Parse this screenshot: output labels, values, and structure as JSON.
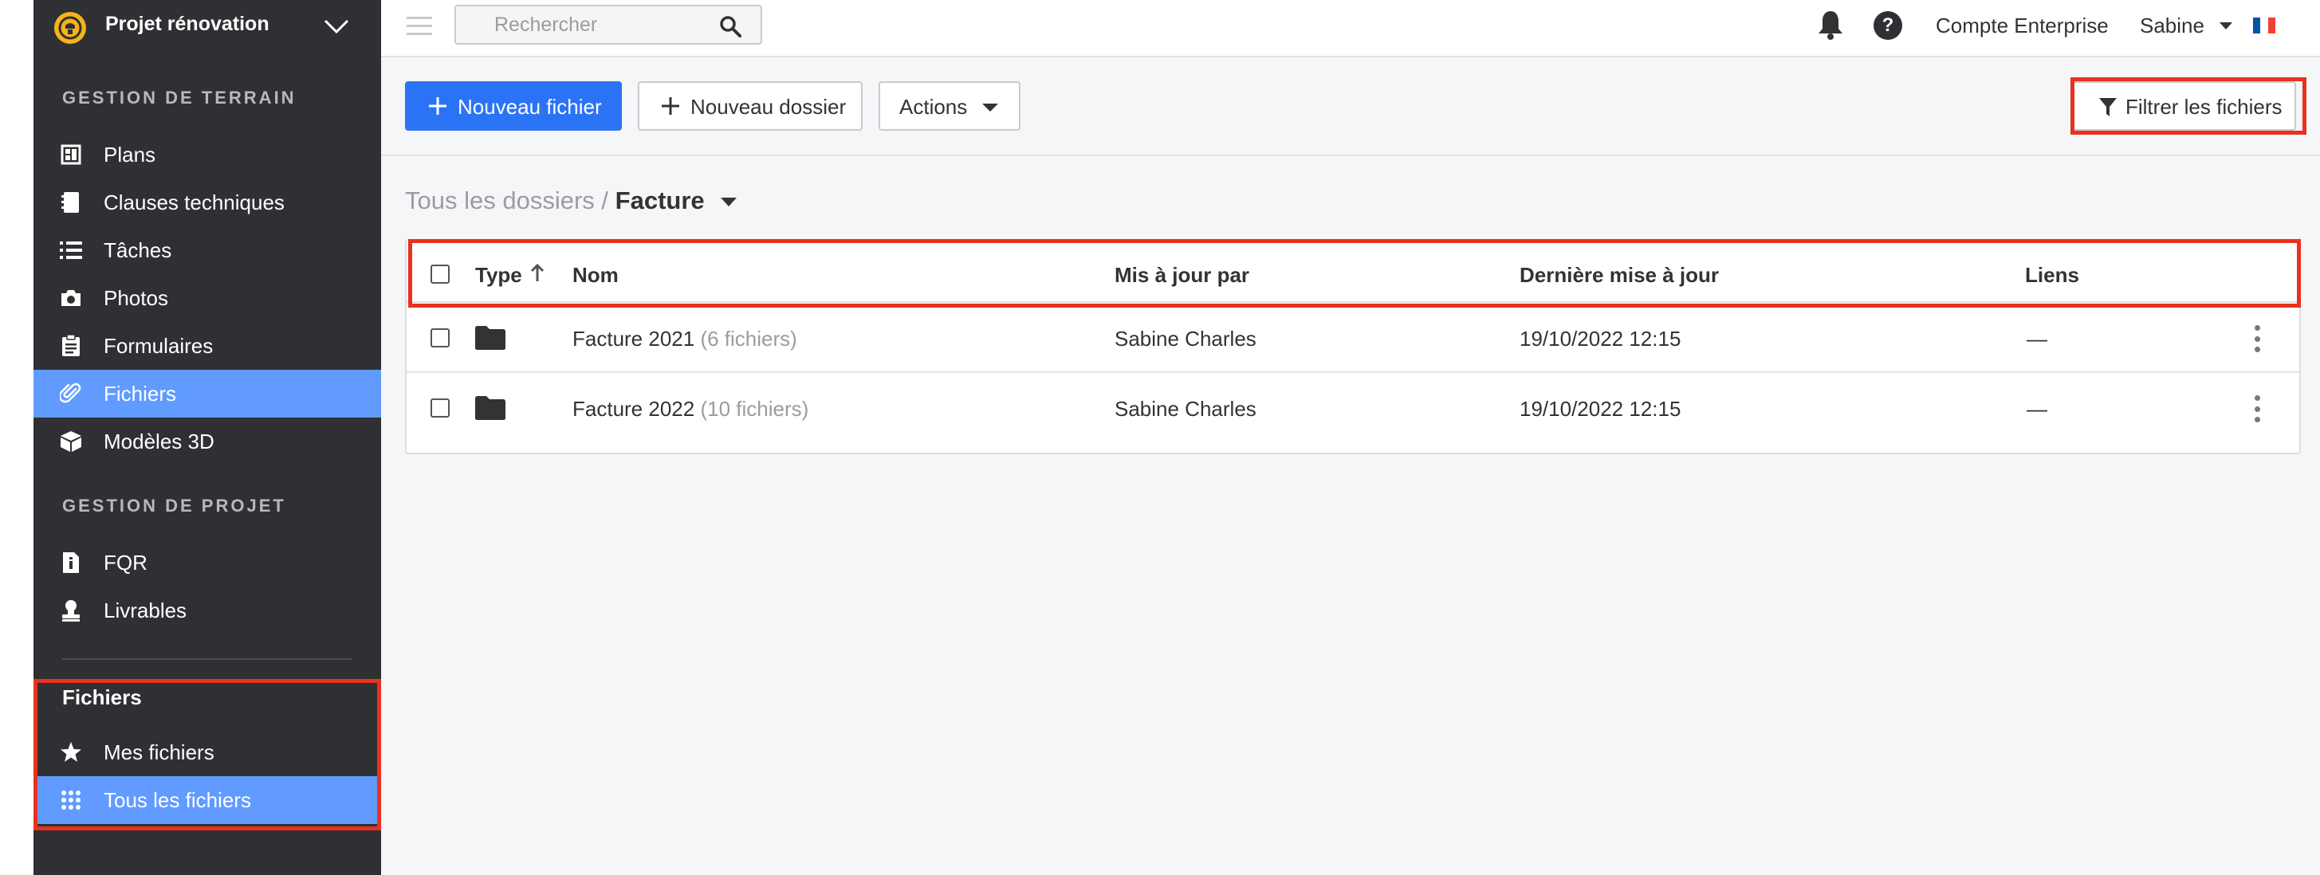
{
  "sidebar": {
    "project_name": "Projet rénovation",
    "section_field": "GESTION DE TERRAIN",
    "field_items": [
      {
        "label": "Plans",
        "icon": "plans-icon"
      },
      {
        "label": "Clauses techniques",
        "icon": "notebook-icon"
      },
      {
        "label": "Tâches",
        "icon": "list-icon"
      },
      {
        "label": "Photos",
        "icon": "camera-icon"
      },
      {
        "label": "Formulaires",
        "icon": "clipboard-icon"
      },
      {
        "label": "Fichiers",
        "icon": "paperclip-icon",
        "active": true
      },
      {
        "label": "Modèles 3D",
        "icon": "cube-icon"
      }
    ],
    "section_project": "GESTION DE PROJET",
    "project_items": [
      {
        "label": "FQR",
        "icon": "info-document-icon"
      },
      {
        "label": "Livrables",
        "icon": "stamp-icon"
      }
    ],
    "files_section_title": "Fichiers",
    "files_items": [
      {
        "label": "Mes fichiers",
        "icon": "star-icon"
      },
      {
        "label": "Tous les fichiers",
        "icon": "grid-icon",
        "active": true
      }
    ]
  },
  "topbar": {
    "search_placeholder": "Rechercher",
    "account_label": "Compte Enterprise",
    "user_label": "Sabine",
    "flag_colors": [
      "#0055a4",
      "#ffffff",
      "#ef4135"
    ]
  },
  "toolbar": {
    "new_file_label": "Nouveau fichier",
    "new_folder_label": "Nouveau dossier",
    "actions_label": "Actions",
    "filter_label": "Filtrer les fichiers"
  },
  "breadcrumb": {
    "root": "Tous les dossiers",
    "separator": "/",
    "current": "Facture"
  },
  "table": {
    "columns": {
      "type": "Type",
      "name": "Nom",
      "updated_by": "Mis à jour par",
      "last_update": "Dernière mise à jour",
      "links": "Liens"
    },
    "rows": [
      {
        "name": "Facture 2021",
        "count": "(6 fichiers)",
        "updated_by": "Sabine Charles",
        "last_update": "19/10/2022 12:15",
        "links": "—"
      },
      {
        "name": "Facture 2022",
        "count": "(10 fichiers)",
        "updated_by": "Sabine Charles",
        "last_update": "19/10/2022 12:15",
        "links": "—"
      }
    ]
  },
  "colors": {
    "sidebar_bg": "#2f3033",
    "sidebar_active": "#619bff",
    "primary_button": "#2b73f5",
    "highlight_red": "#e8321e",
    "logo_yellow": "#f4b41a"
  }
}
